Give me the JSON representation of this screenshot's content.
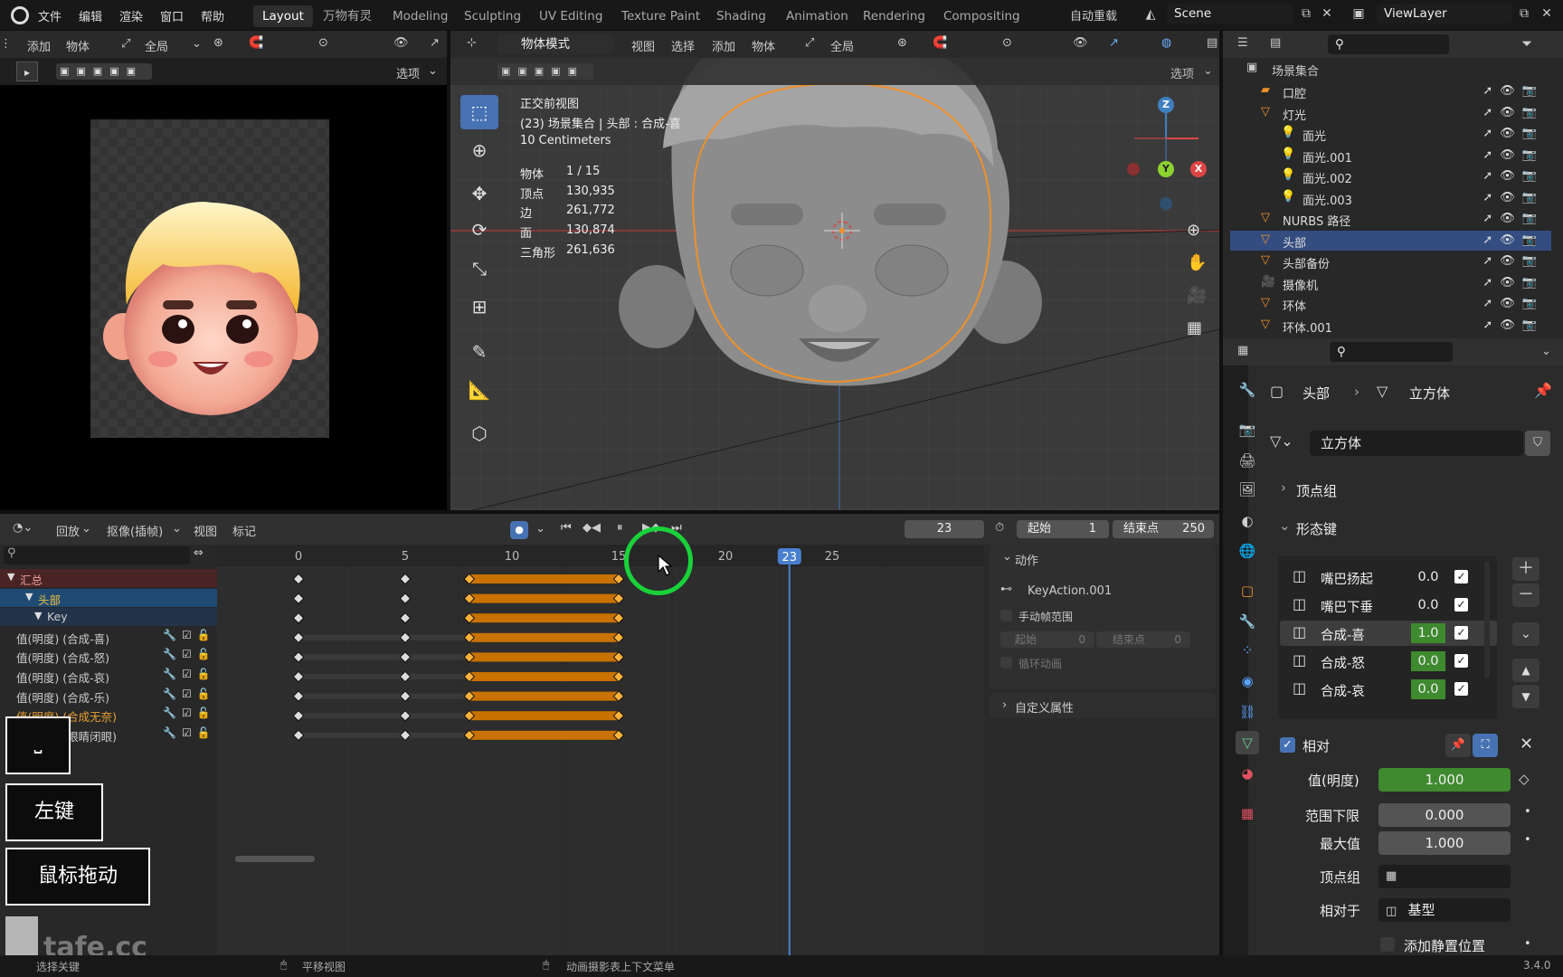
{
  "topbar": {
    "menus": [
      "文件",
      "编辑",
      "渲染",
      "窗口",
      "帮助"
    ],
    "workspaces": [
      "Layout",
      "万物有灵",
      "Modeling",
      "Sculpting",
      "UV Editing",
      "Texture Paint",
      "Shading",
      "Animation",
      "Rendering",
      "Compositing"
    ],
    "active_workspace": "Layout",
    "auto_keying": "自动重载",
    "scene": "Scene",
    "view_layer": "ViewLayer"
  },
  "left_viewport": {
    "menus": [
      "添加",
      "物体"
    ],
    "transform": "全局",
    "options": "选项"
  },
  "viewport": {
    "mode": "物体模式",
    "menus": [
      "视图",
      "选择",
      "添加",
      "物体"
    ],
    "transform": "全局",
    "options": "选项",
    "view_name": "正交前视图",
    "context": "(23) 场景集合 | 头部 : 合成-喜",
    "scale": "10 Centimeters",
    "stats": [
      {
        "label": "物体",
        "value": "1 / 15"
      },
      {
        "label": "顶点",
        "value": "130,935"
      },
      {
        "label": "边",
        "value": "261,772"
      },
      {
        "label": "面",
        "value": "130,874"
      },
      {
        "label": "三角形",
        "value": "261,636"
      }
    ],
    "gizmo": {
      "z": "Z",
      "y": "Y",
      "x": "X"
    }
  },
  "outliner": {
    "root": "场景集合",
    "items": [
      {
        "name": "口腔",
        "indent": 1
      },
      {
        "name": "灯光",
        "indent": 1
      },
      {
        "name": "面光",
        "indent": 2
      },
      {
        "name": "面光.001",
        "indent": 2
      },
      {
        "name": "面光.002",
        "indent": 2
      },
      {
        "name": "面光.003",
        "indent": 2
      },
      {
        "name": "NURBS 路径",
        "indent": 1
      },
      {
        "name": "头部",
        "indent": 1,
        "selected": true
      },
      {
        "name": "头部备份",
        "indent": 1
      },
      {
        "name": "摄像机",
        "indent": 1
      },
      {
        "name": "环体",
        "indent": 1
      },
      {
        "name": "环体.001",
        "indent": 1
      }
    ]
  },
  "properties": {
    "breadcrumb_object": "头部",
    "breadcrumb_data": "立方体",
    "mesh_name": "立方体",
    "section_vertex_groups": "顶点组",
    "section_shape_keys": "形态键",
    "shape_keys": [
      {
        "name": "嘴巴扬起",
        "value": "0.0",
        "green": false
      },
      {
        "name": "嘴巴下垂",
        "value": "0.0",
        "green": false
      },
      {
        "name": "合成-喜",
        "value": "1.0",
        "green": true,
        "active": true
      },
      {
        "name": "合成-怒",
        "value": "0.0",
        "green": true
      },
      {
        "name": "合成-哀",
        "value": "0.0",
        "green": true
      }
    ],
    "relative_label": "相对",
    "value_label": "值(明度)",
    "value": "1.000",
    "range_min_label": "范围下限",
    "range_min": "0.000",
    "max_label": "最大值",
    "max": "1.000",
    "vgroup_label": "顶点组",
    "relative_to_label": "相对于",
    "relative_to": "基型",
    "add_rest": "添加静置位置"
  },
  "dopesheet": {
    "mode": "回放",
    "editor": "抠像(插帧)",
    "menus": [
      "视图",
      "标记"
    ],
    "current_frame": "23",
    "start_label": "起始",
    "start": "1",
    "end_label": "结束点",
    "end": "250",
    "ruler": [
      {
        "label": "0",
        "frame": 0
      },
      {
        "label": "5",
        "frame": 5
      },
      {
        "label": "10",
        "frame": 10
      },
      {
        "label": "15",
        "frame": 15
      },
      {
        "label": "20",
        "frame": 20
      },
      {
        "label": "25",
        "frame": 25
      }
    ],
    "channels": [
      {
        "name": "汇总",
        "type": "summary"
      },
      {
        "name": "头部",
        "type": "object"
      },
      {
        "name": "Key",
        "type": "key"
      },
      {
        "name": "值(明度) (合成-喜)",
        "type": "fcurve"
      },
      {
        "name": "值(明度) (合成-怒)",
        "type": "fcurve"
      },
      {
        "name": "值(明度) (合成-哀)",
        "type": "fcurve"
      },
      {
        "name": "值(明度) (合成-乐)",
        "type": "fcurve"
      },
      {
        "name": "值(明度) (合成无奈)",
        "type": "fcurve",
        "orange": true
      },
      {
        "name": "值(明度) (眼睛闭眼)",
        "type": "fcurve"
      }
    ],
    "keyframes": [
      0,
      5,
      8,
      15
    ],
    "action_panel": {
      "title": "动作",
      "action_name": "KeyAction.001",
      "manual_range": "手动帧范围",
      "start_label": "起始",
      "start": "0",
      "end_label": "结束点",
      "end": "0",
      "cyclic": "循环动画",
      "custom_props": "自定义属性"
    }
  },
  "overlay_keys": {
    "k1": "左键",
    "k2": "鼠标拖动",
    "k3": "⎵"
  },
  "statusbar": {
    "left": "选择关键",
    "middle": "平移视图",
    "right": "动画摄影表上下文菜单",
    "version": "3.4.0"
  },
  "watermark": "tafe.cc"
}
